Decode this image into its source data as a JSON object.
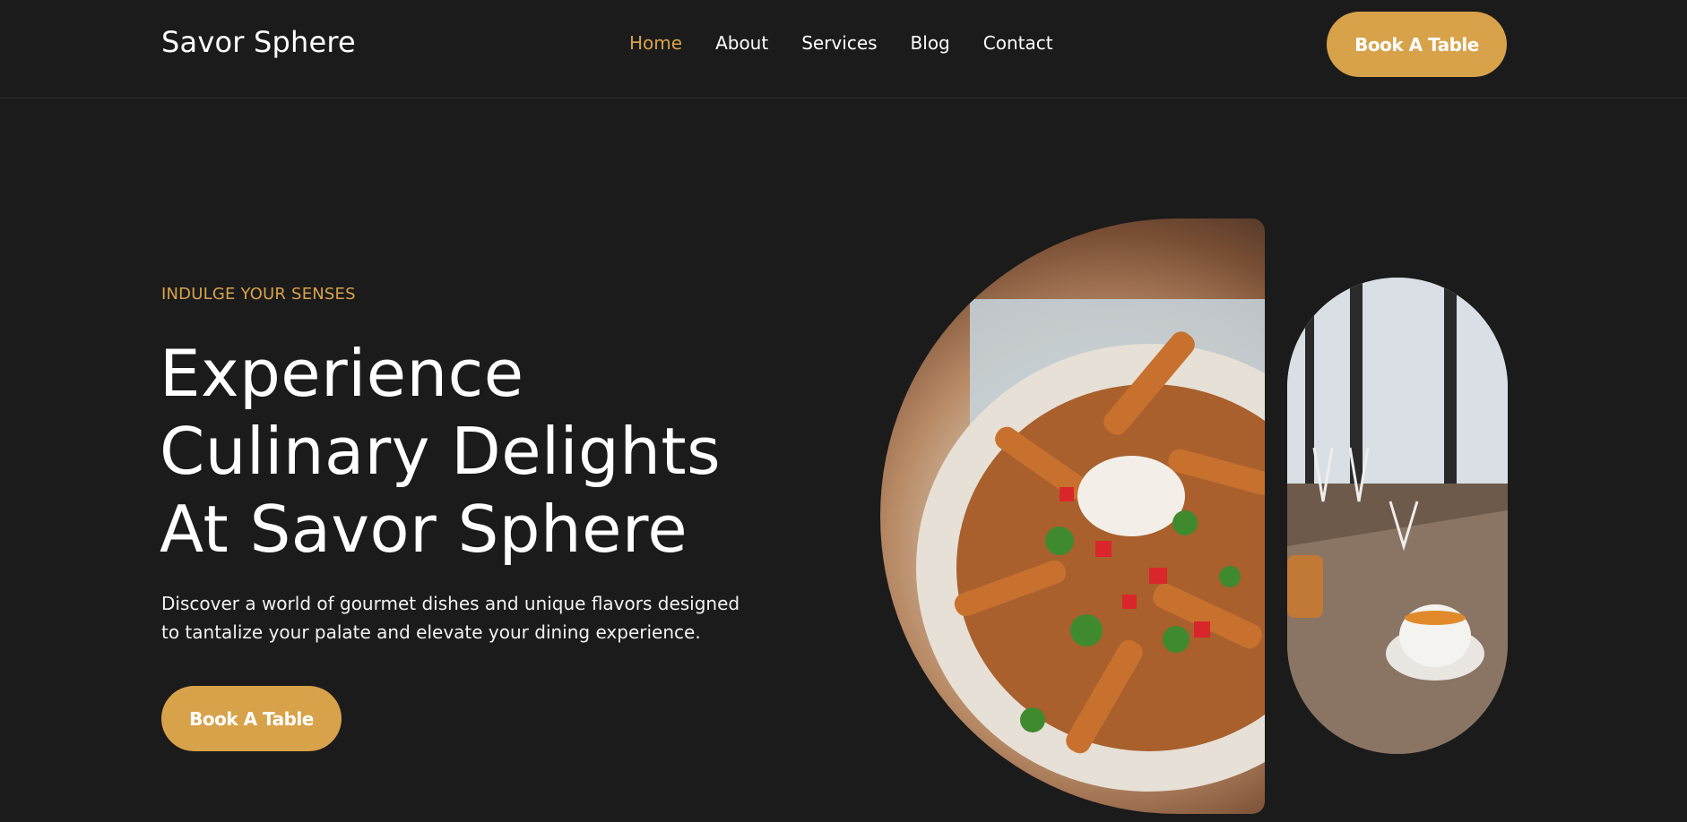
{
  "header": {
    "logo": "Savor Sphere",
    "nav": [
      "Home",
      "About",
      "Services",
      "Blog",
      "Contact"
    ],
    "active_nav": "Home",
    "cta_label": "Book A Table"
  },
  "hero": {
    "eyebrow": "INDULGE YOUR SENSES",
    "headline": "Experience Culinary Delights At Savor Sphere",
    "description": "Discover a world of gourmet dishes and unique flavors designed to tantalize your palate and elevate your dining experience.",
    "cta_label": "Book A Table"
  },
  "colors": {
    "background": "#1b1b1b",
    "accent": "#d8a24a",
    "text": "#ffffff"
  }
}
